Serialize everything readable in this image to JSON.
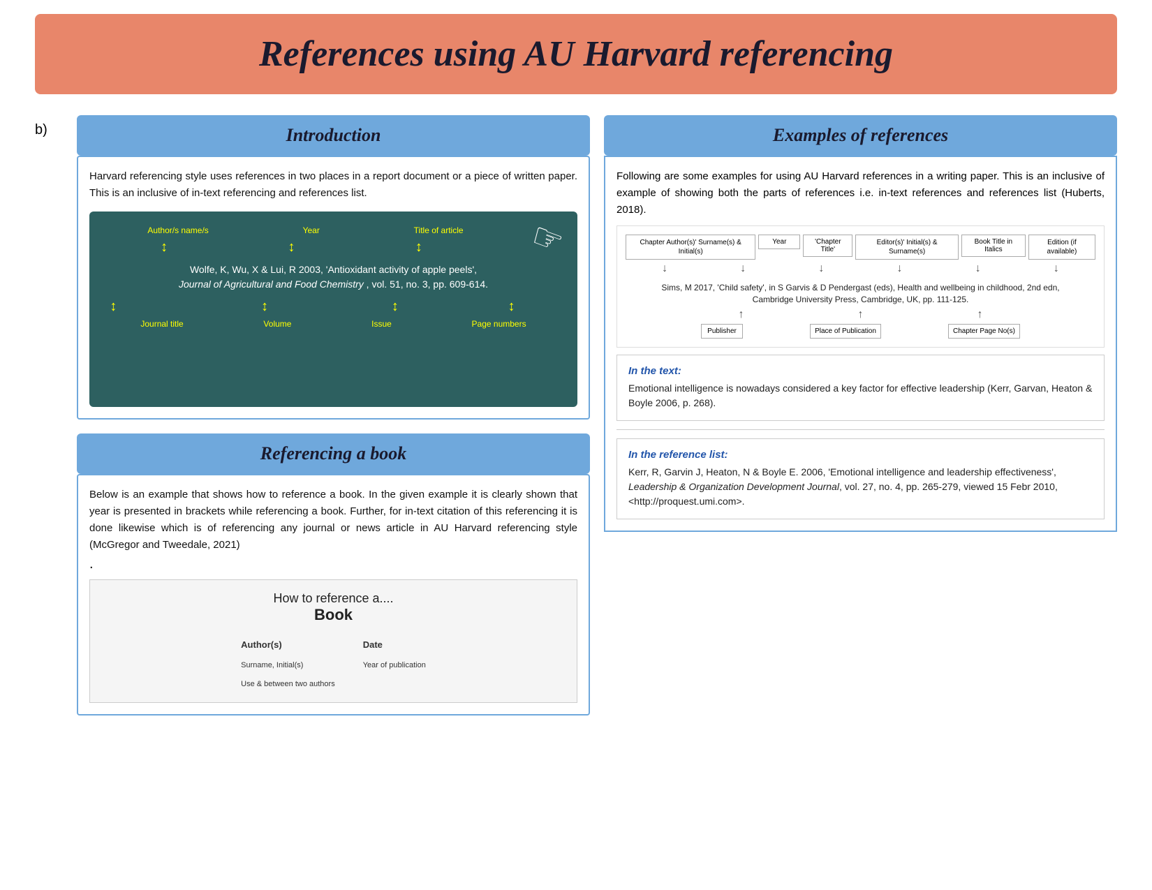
{
  "title": "References using AU Harvard referencing",
  "b_label": "b)",
  "left": {
    "intro_header": "Introduction",
    "intro_text": "Harvard referencing style uses references in two places in a report document or a piece of written paper. This is an inclusive of in-text referencing and references list.",
    "diagram": {
      "label_author": "Author/s name/s",
      "label_year": "Year",
      "label_title": "Title of article",
      "citation": "Wolfe, K, Wu, X & Lui, R 2003, 'Antioxidant activity of apple peels',",
      "citation_italic": "Journal of Agricultural and Food Chemistry",
      "citation_end": " , vol. 51, no. 3, pp. 609-614.",
      "label_journal": "Journal title",
      "label_volume": "Volume",
      "label_issue": "Issue",
      "label_pages": "Page numbers"
    },
    "book_header": "Referencing a book",
    "book_text": "Below is an example that shows how to reference a book. In the given example it is clearly shown that year is presented in brackets while referencing a book. Further, for in-text citation of this referencing it is done likewise which is of referencing any journal or news article in AU Harvard referencing style (McGregor and Tweedale, 2021)",
    "book_diagram": {
      "line1": "How to reference a....",
      "line2": "Book",
      "author_label": "Author(s)",
      "author_sub": "Surname, Initial(s)",
      "author_note": "Use & between two authors",
      "date_label": "Date",
      "date_sub": "Year of publication"
    }
  },
  "right": {
    "examples_header": "Examples of references",
    "intro_text": "Following are some examples for using AU Harvard references in a writing paper. This is an inclusive of example of showing both the parts of references i.e. in-text references and references list (Huberts, 2018).",
    "ref_diagram": {
      "box1": "Chapter Author(s)' Surname(s) & Initial(s)",
      "box2": "Year",
      "box3": "'Chapter Title'",
      "box4": "Editor(s)' Initial(s) & Surname(s)",
      "box5": "Book Title in Italics",
      "box6": "Edition (if available)",
      "citation": "Sims, M 2017, 'Child safety', in S Garvis & D Pendergast (eds), Health and wellbeing in childhood, 2nd edn,",
      "citation2": "Cambridge University Press, Cambridge, UK, pp. 111-125.",
      "box_bottom1": "Publisher",
      "box_bottom2": "Place of Publication",
      "box_bottom3": "Chapter Page No(s)"
    },
    "in_text_label": "In the text:",
    "in_text": "Emotional intelligence is nowadays considered a key factor for effective leadership (Kerr, Garvan, Heaton & Boyle 2006, p. 268).",
    "ref_list_label": "In the reference list:",
    "ref_list": "Kerr, R, Garvin J, Heaton, N & Boyle E. 2006, 'Emotional intelligence and leadership effectiveness', Leadership & Organization Development Journal, vol. 27, no. 4, pp. 265-279, viewed 15 Febr 2010, <http://proquest.umi.com>.",
    "ref_list_italic": "Leadership & Organization Development Journal"
  }
}
